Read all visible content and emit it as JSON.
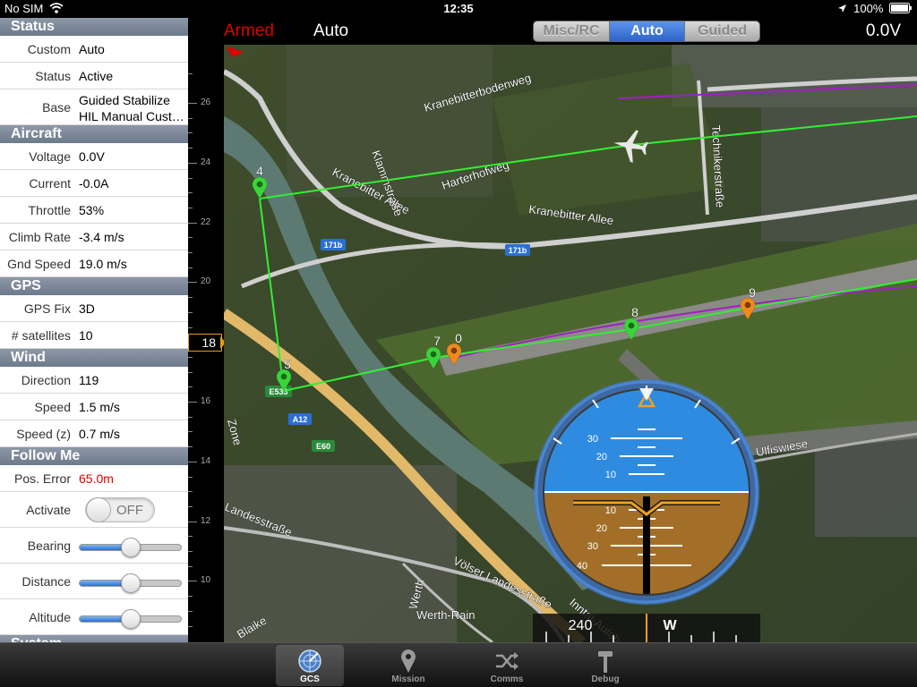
{
  "status_bar": {
    "carrier": "No SIM",
    "time": "12:35",
    "battery": "100%"
  },
  "top_bar": {
    "armed": "Armed",
    "mode": "Auto",
    "segments": [
      "Misc/RC",
      "Auto",
      "Guided"
    ],
    "active_segment": "Auto",
    "voltage": "0.0V"
  },
  "panel": {
    "status": {
      "title": "Status",
      "rows": [
        {
          "label": "Custom",
          "value": "Auto"
        },
        {
          "label": "Status",
          "value": "Active"
        },
        {
          "label": "Base",
          "value": "Guided Stabilize",
          "value2": "HIL Manual Cust…"
        }
      ]
    },
    "aircraft": {
      "title": "Aircraft",
      "rows": [
        {
          "label": "Voltage",
          "value": "0.0V"
        },
        {
          "label": "Current",
          "value": "-0.0A"
        },
        {
          "label": "Throttle",
          "value": "53%"
        },
        {
          "label": "Climb Rate",
          "value": "-3.4 m/s"
        },
        {
          "label": "Gnd Speed",
          "value": "19.0 m/s"
        }
      ]
    },
    "gps": {
      "title": "GPS",
      "rows": [
        {
          "label": "GPS Fix",
          "value": "3D"
        },
        {
          "label": "# satellites",
          "value": "10"
        }
      ]
    },
    "wind": {
      "title": "Wind",
      "rows": [
        {
          "label": "Direction",
          "value": "119"
        },
        {
          "label": "Speed",
          "value": "1.5 m/s"
        },
        {
          "label": "Speed (z)",
          "value": "0.7 m/s"
        }
      ]
    },
    "follow_me": {
      "title": "Follow Me",
      "pos_error_label": "Pos. Error",
      "pos_error_value": "65.0m",
      "activate_label": "Activate",
      "activate_state": "OFF",
      "bearing_label": "Bearing",
      "bearing_level": 0.5,
      "distance_label": "Distance",
      "distance_level": 0.5,
      "altitude_label": "Altitude",
      "altitude_level": 0.5
    },
    "system": {
      "title": "System"
    }
  },
  "altitude_tape": {
    "labels": [
      "26",
      "24",
      "22",
      "20",
      "18",
      "16",
      "14",
      "12",
      "10"
    ],
    "current": "18"
  },
  "map": {
    "streets": [
      "Kranebitterbodenweg",
      "Harterhofweg",
      "Klammstraße",
      "Kranebitter Allee",
      "Kranebitter Allee",
      "Technikerstraße",
      "Ulfiswiese",
      "Völser Landesstraße",
      "Landesstraße",
      "Werth",
      "Werth-Rain",
      "Blaike",
      "Inntal-Autob",
      "Zone"
    ],
    "shields": [
      "171b",
      "171b",
      "E533",
      "A12",
      "E60"
    ],
    "waypoints": [
      {
        "label": "4",
        "color": "green"
      },
      {
        "label": "5",
        "color": "green"
      },
      {
        "label": "7",
        "color": "green"
      },
      {
        "label": "0",
        "color": "orange"
      },
      {
        "label": "8",
        "color": "green"
      },
      {
        "label": "9",
        "color": "orange"
      }
    ]
  },
  "horizon": {
    "pitch_labels": [
      "30",
      "20",
      "10",
      "10",
      "20",
      "30",
      "40"
    ],
    "heading_labels": [
      "240",
      "W"
    ]
  },
  "tabs": [
    {
      "label": "GCS",
      "icon": "radar-icon",
      "active": true
    },
    {
      "label": "Mission",
      "icon": "map-pin-icon",
      "active": false
    },
    {
      "label": "Comms",
      "icon": "shuffle-icon",
      "active": false
    },
    {
      "label": "Debug",
      "icon": "hammer-icon",
      "active": false
    }
  ],
  "colors": {
    "armed": "#e00000",
    "accent": "#e89a1c",
    "path": "#33ee33",
    "track": "#a020c0",
    "segment_active": "#3a72d6"
  }
}
